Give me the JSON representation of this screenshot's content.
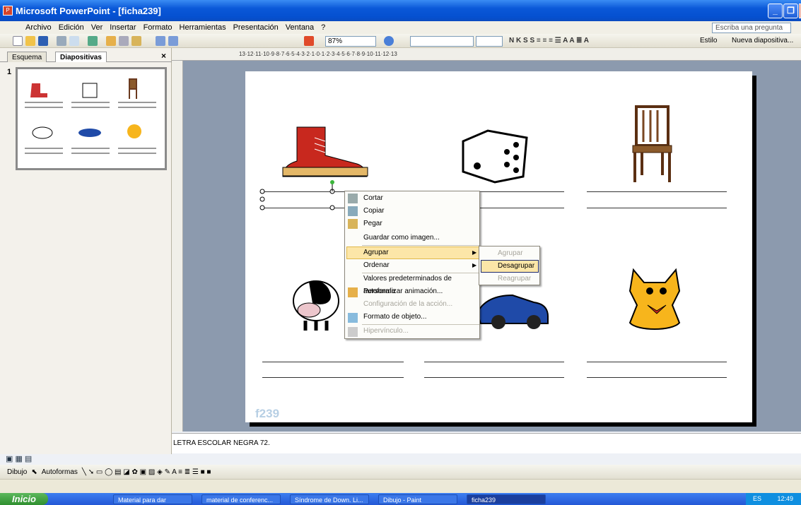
{
  "window": {
    "title": "Microsoft PowerPoint - [ficha239]"
  },
  "menu": [
    "Archivo",
    "Edición",
    "Ver",
    "Insertar",
    "Formato",
    "Herramientas",
    "Presentación",
    "Ventana",
    "?"
  ],
  "ask_placeholder": "Escriba una pregunta",
  "toolbar": {
    "zoom": "87%",
    "estilo": "Estilo",
    "nueva": "Nueva diapositiva..."
  },
  "panel": {
    "tabs": [
      "Esquema",
      "Diapositivas"
    ],
    "close": "×",
    "slide_number": "1"
  },
  "ruler": "13·12·11·10·9·8·7·6·5·4·3·2·1·0·1·2·3·4·5·6·7·8·9·10·11·12·13",
  "slide": {
    "watermark": "f239",
    "images": [
      "boot-image",
      "die-image",
      "chair-image",
      "cow-image",
      "car-image",
      "cat-image"
    ]
  },
  "notes": "LETRA ESCOLAR NEGRA 72.",
  "context_menu": {
    "items": [
      "Cortar",
      "Copiar",
      "Pegar",
      "Guardar como imagen...",
      "Agrupar",
      "Ordenar",
      "Valores predeterminados de autoforma",
      "Personalizar animación...",
      "Configuración de la acción...",
      "Formato de objeto...",
      "Hipervínculo..."
    ]
  },
  "submenu": {
    "items": [
      "Agrupar",
      "Desagrupar",
      "Reagrupar"
    ]
  },
  "drawbar": {
    "dibujo": "Dibujo",
    "autoformas": "Autoformas"
  },
  "taskbar": {
    "start": "Inicio",
    "tasks": [
      "Material para dar",
      "material de conferenc...",
      "Síndrome de Down. Li...",
      "Dibujo - Paint",
      "ficha239"
    ],
    "clock": "12:49",
    "lang": "ES"
  },
  "colors": {
    "title": "#0a58d8",
    "highlight": "#fce6a8",
    "taskbar": "#2458d6"
  }
}
